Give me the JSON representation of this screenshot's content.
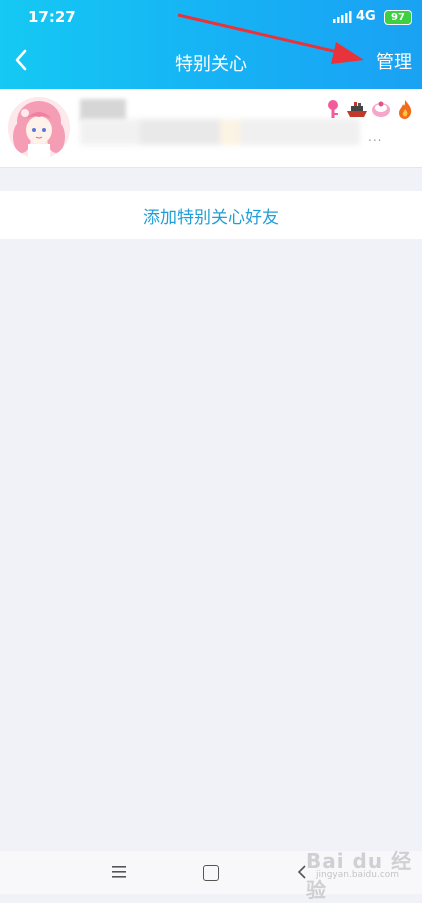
{
  "status_bar": {
    "time": "17:27",
    "network": "4G",
    "battery": "97"
  },
  "nav": {
    "title": "特别关心",
    "manage_label": "管理"
  },
  "friend": {
    "more_indicator": "..."
  },
  "add_friend": {
    "label": "添加特别关心好友"
  },
  "watermark": {
    "brand": "Bai du 经验",
    "url": "jingyan.baidu.com"
  },
  "colors": {
    "header_start": "#15c9f3",
    "header_end": "#1aa1f3",
    "link": "#1f9fd7",
    "background": "#f1f2f7",
    "arrow": "#e8333a"
  }
}
